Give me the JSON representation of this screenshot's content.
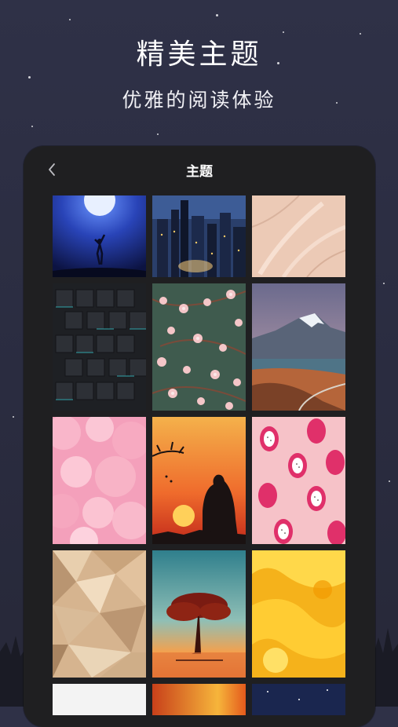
{
  "hero": {
    "title": "精美主题",
    "subtitle": "优雅的阅读体验"
  },
  "screen": {
    "title": "主题",
    "back_icon": "chevron-left-icon"
  },
  "themes": [
    {
      "subject": "moon-dancer",
      "colors": [
        "#1b2a7a",
        "#4e7cff",
        "#0a0f2c"
      ]
    },
    {
      "subject": "night-city",
      "colors": [
        "#20325a",
        "#ffcc66",
        "#0b1222"
      ]
    },
    {
      "subject": "beige-texture",
      "colors": [
        "#eec9b4",
        "#f5dccc"
      ]
    },
    {
      "subject": "dark-cubes",
      "colors": [
        "#222428",
        "#3de0e8"
      ]
    },
    {
      "subject": "cherry-blossom",
      "colors": [
        "#3d5a4d",
        "#f3c4c6",
        "#7a4b3a"
      ]
    },
    {
      "subject": "mountain-lake",
      "colors": [
        "#6b6a8d",
        "#e7ebf1",
        "#3e5560",
        "#c0683f"
      ]
    },
    {
      "subject": "pink-spheres",
      "colors": [
        "#f6a6bf",
        "#ffd2df"
      ]
    },
    {
      "subject": "sunset-silhouette",
      "colors": [
        "#f5a13a",
        "#e4402a",
        "#1a1212"
      ]
    },
    {
      "subject": "dragon-fruit",
      "colors": [
        "#f6c2c8",
        "#e0306a",
        "#ffffff"
      ]
    },
    {
      "subject": "beige-polygons",
      "colors": [
        "#d6b48f",
        "#f1dcc0",
        "#a88461"
      ]
    },
    {
      "subject": "red-tree",
      "colors": [
        "#3a8a97",
        "#f59a4a",
        "#7a1b12"
      ]
    },
    {
      "subject": "yellow-fluid",
      "colors": [
        "#f5b21b",
        "#ffd84a",
        "#f29a00"
      ]
    },
    {
      "subject": "white-partial",
      "colors": [
        "#f3f3f3"
      ]
    },
    {
      "subject": "sunset-partial",
      "colors": [
        "#e45a1c",
        "#f6b53b"
      ]
    },
    {
      "subject": "night-partial",
      "colors": [
        "#1d2a55",
        "#0d1530"
      ]
    }
  ]
}
